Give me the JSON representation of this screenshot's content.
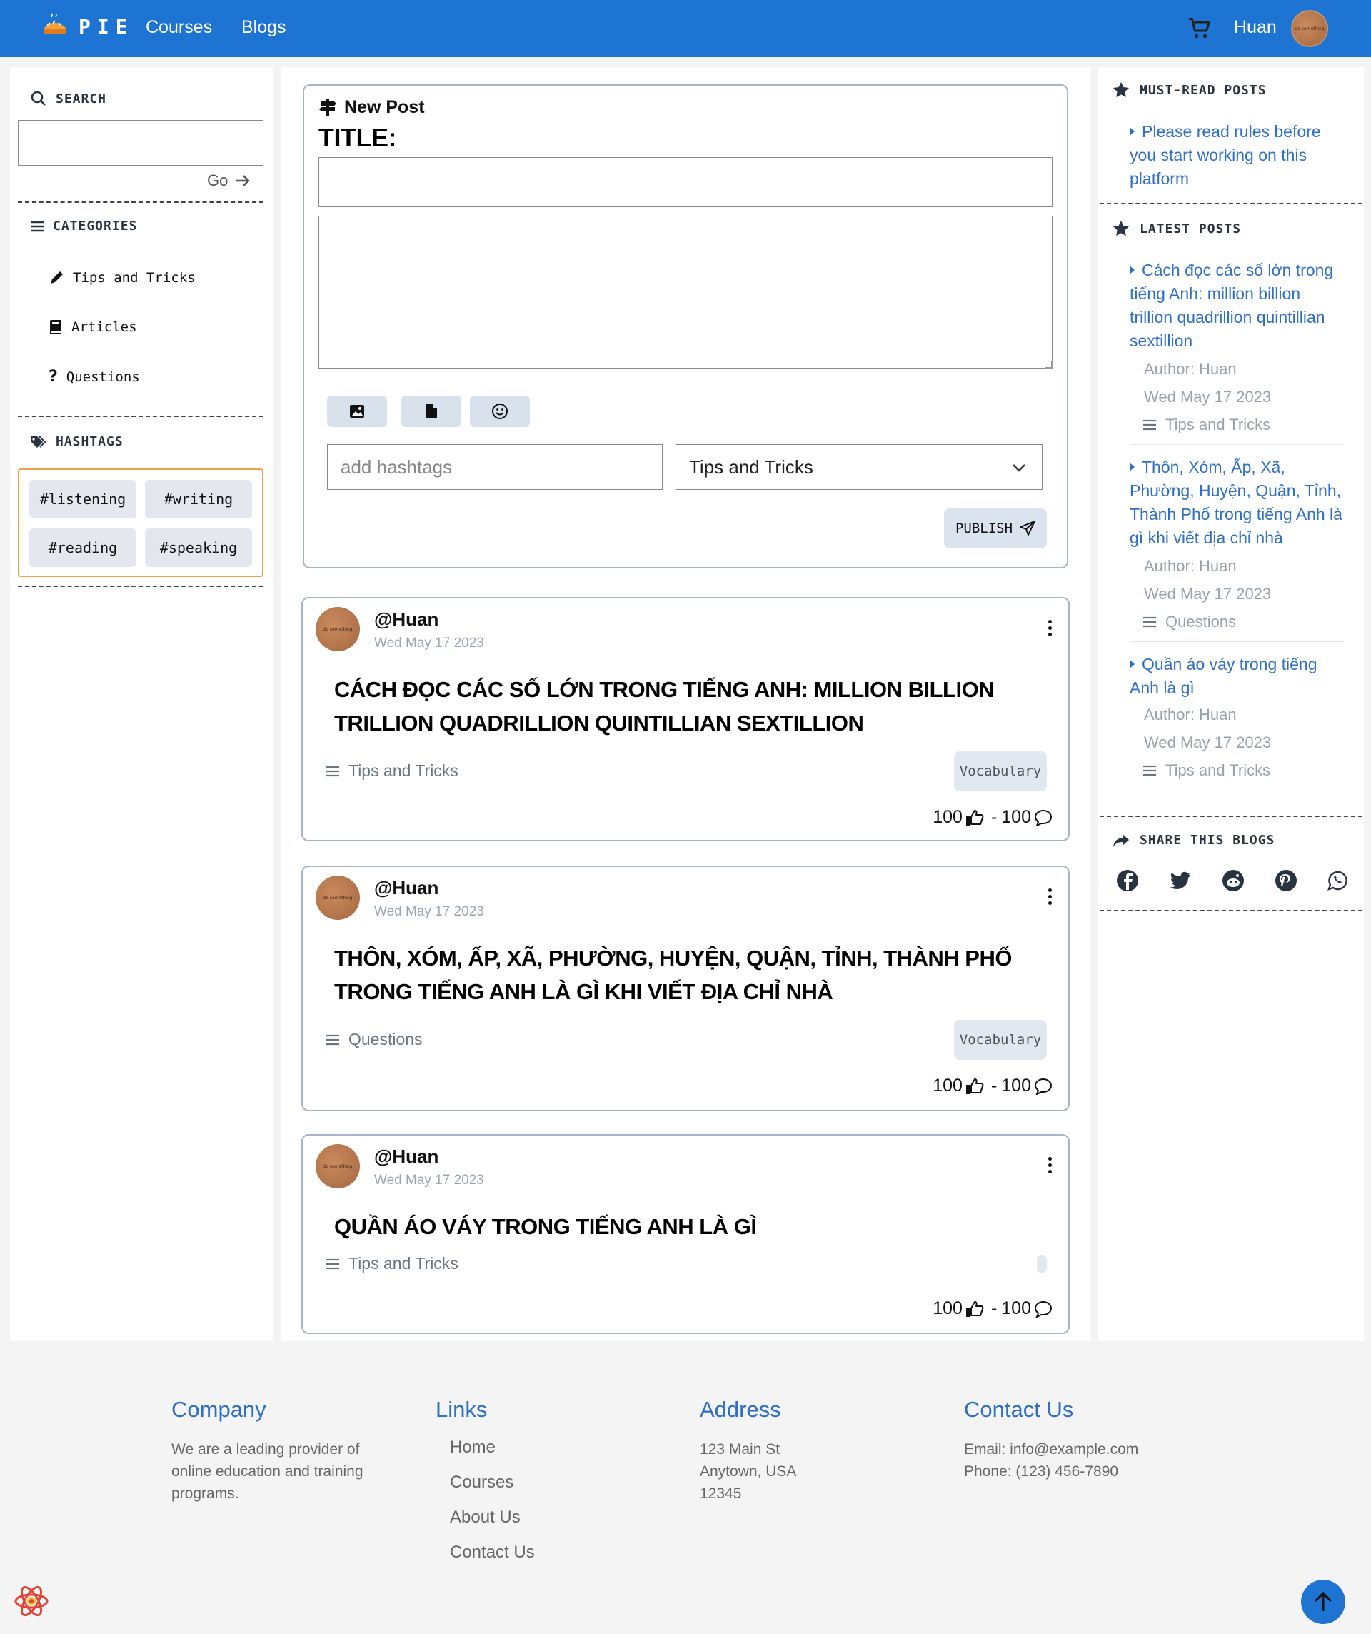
{
  "header": {
    "brand": "PIE",
    "nav": [
      "Courses",
      "Blogs"
    ],
    "user": "Huan",
    "avatar_text": "do something",
    "brand_color": "#1e74d2"
  },
  "left": {
    "search_title": "SEARCH",
    "search_value": "",
    "go_label": "Go",
    "categories_title": "CATEGORIES",
    "categories": [
      "Tips and Tricks",
      "Articles",
      "Questions"
    ],
    "hashtags_title": "HASHTAGS",
    "hashtags": [
      "#listening",
      "#writing",
      "#reading",
      "#speaking"
    ]
  },
  "new_post": {
    "heading": "New Post",
    "title_label": "TITLE:",
    "title_value": "",
    "body_value": "",
    "hashtag_placeholder": "add hashtags",
    "category_selected": "Tips and Tricks",
    "publish_label": "PUBLISH"
  },
  "posts": [
    {
      "user": "@Huan",
      "date": "Wed May 17 2023",
      "title": "Cách đọc các số lớn trong tiếng Anh: million billion trillion quadrillion quintillian sextillion",
      "category": "Tips and Tricks",
      "tag": "Vocabulary",
      "likes": "100",
      "sep": "-",
      "comments": "100"
    },
    {
      "user": "@Huan",
      "date": "Wed May 17 2023",
      "title": "Thôn, Xóm, Ấp, Xã, Phường, Huyện, Quận, Tỉnh, Thành Phố trong tiếng Anh là gì khi viết địa chỉ nhà",
      "category": "Questions",
      "tag": "Vocabulary",
      "likes": "100",
      "sep": "-",
      "comments": "100"
    },
    {
      "user": "@Huan",
      "date": "Wed May 17 2023",
      "title": "Quần áo váy trong tiếng Anh là gì",
      "category": "Tips and Tricks",
      "tag": "",
      "likes": "100",
      "sep": "-",
      "comments": "100"
    }
  ],
  "right": {
    "must_read_title": "MUST-READ POSTS",
    "must_read": [
      "Please read rules before you start working on this platform"
    ],
    "latest_title": "LATEST POSTS",
    "latest": [
      {
        "title": "Cách đọc các số lớn trong tiếng Anh: million billion trillion quadrillion quintillian sextillion",
        "author": "Author: Huan",
        "date": "Wed May 17 2023",
        "category": "Tips and Tricks"
      },
      {
        "title": "Thôn, Xóm, Ấp, Xã, Phường, Huyện, Quận, Tỉnh, Thành Phố trong tiếng Anh là gì khi viết địa chỉ nhà",
        "author": "Author: Huan",
        "date": "Wed May 17 2023",
        "category": "Questions"
      },
      {
        "title": "Quần áo váy trong tiếng Anh là gì",
        "author": "Author: Huan",
        "date": "Wed May 17 2023",
        "category": "Tips and Tricks"
      }
    ],
    "share_title": "SHARE THIS BLOGS",
    "share_icons": [
      "facebook-icon",
      "twitter-icon",
      "reddit-icon",
      "pinterest-icon",
      "whatsapp-icon"
    ]
  },
  "footer": {
    "company_title": "Company",
    "company_text": "We are a leading provider of online education and training programs.",
    "links_title": "Links",
    "links": [
      "Home",
      "Courses",
      "About Us",
      "Contact Us"
    ],
    "address_title": "Address",
    "address_lines": [
      "123 Main St",
      "Anytown, USA",
      "12345"
    ],
    "contact_title": "Contact Us",
    "email": "Email: info@example.com",
    "phone": "Phone: (123) 456-7890"
  }
}
